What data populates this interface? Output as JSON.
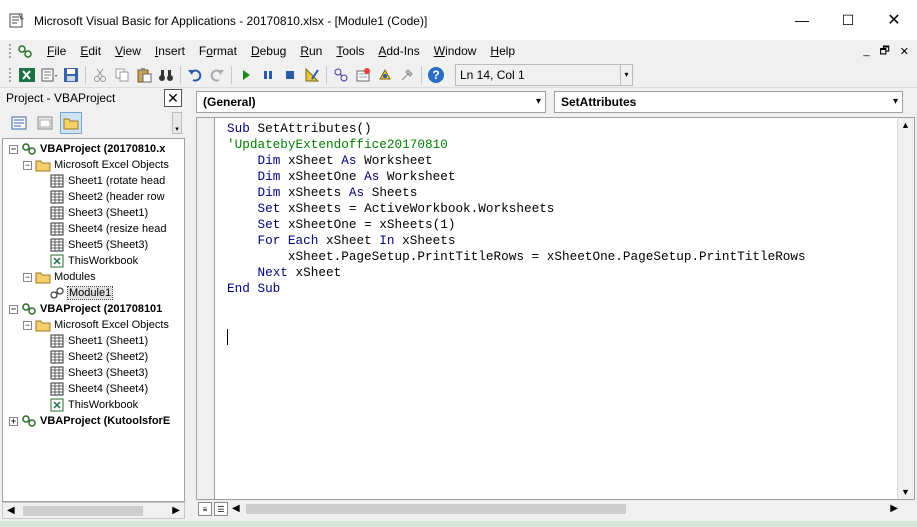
{
  "window": {
    "title": "Microsoft Visual Basic for Applications - 20170810.xlsx - [Module1 (Code)]",
    "minimize": "—",
    "maximize": "☐",
    "close": "✕"
  },
  "menu": {
    "items": [
      {
        "label": "File",
        "accel": "F",
        "rest": "ile"
      },
      {
        "label": "Edit",
        "accel": "E",
        "rest": "dit"
      },
      {
        "label": "View",
        "accel": "V",
        "rest": "iew"
      },
      {
        "label": "Insert",
        "accel": "I",
        "rest": "nsert"
      },
      {
        "label": "Format",
        "accel": "o",
        "pre": "F",
        "rest": "rmat"
      },
      {
        "label": "Debug",
        "accel": "D",
        "rest": "ebug"
      },
      {
        "label": "Run",
        "accel": "R",
        "rest": "un"
      },
      {
        "label": "Tools",
        "accel": "T",
        "rest": "ools"
      },
      {
        "label": "Add-Ins",
        "accel": "A",
        "rest": "dd-Ins"
      },
      {
        "label": "Window",
        "accel": "W",
        "rest": "indow"
      },
      {
        "label": "Help",
        "accel": "H",
        "rest": "elp"
      }
    ],
    "mdi_min": "_",
    "mdi_restore": "🗗",
    "mdi_close": "✕"
  },
  "toolbar": {
    "position": "Ln 14, Col 1"
  },
  "project": {
    "header": "Project - VBAProject",
    "close": "✕",
    "tree": [
      {
        "label": "VBAProject (20170810.x",
        "level": 0,
        "expander": "−",
        "bold": true,
        "icon": "vbaproject-icon"
      },
      {
        "label": "Microsoft Excel Objects",
        "level": 1,
        "expander": "−",
        "icon": "folder-icon"
      },
      {
        "label": "Sheet1 (rotate head",
        "level": 2,
        "icon": "sheet-icon"
      },
      {
        "label": "Sheet2 (header row",
        "level": 2,
        "icon": "sheet-icon"
      },
      {
        "label": "Sheet3 (Sheet1)",
        "level": 2,
        "icon": "sheet-icon"
      },
      {
        "label": "Sheet4 (resize head",
        "level": 2,
        "icon": "sheet-icon"
      },
      {
        "label": "Sheet5 (Sheet3)",
        "level": 2,
        "icon": "sheet-icon"
      },
      {
        "label": "ThisWorkbook",
        "level": 2,
        "icon": "workbook-icon"
      },
      {
        "label": "Modules",
        "level": 1,
        "expander": "−",
        "icon": "folder-icon"
      },
      {
        "label": "Module1",
        "level": 2,
        "icon": "module-icon",
        "selected": true
      },
      {
        "label": "VBAProject (201708101",
        "level": 0,
        "expander": "−",
        "bold": true,
        "icon": "vbaproject-icon"
      },
      {
        "label": "Microsoft Excel Objects",
        "level": 1,
        "expander": "−",
        "icon": "folder-icon"
      },
      {
        "label": "Sheet1 (Sheet1)",
        "level": 2,
        "icon": "sheet-icon"
      },
      {
        "label": "Sheet2 (Sheet2)",
        "level": 2,
        "icon": "sheet-icon"
      },
      {
        "label": "Sheet3 (Sheet3)",
        "level": 2,
        "icon": "sheet-icon"
      },
      {
        "label": "Sheet4 (Sheet4)",
        "level": 2,
        "icon": "sheet-icon"
      },
      {
        "label": "ThisWorkbook",
        "level": 2,
        "icon": "workbook-icon"
      },
      {
        "label": "VBAProject (KutoolsforE",
        "level": 0,
        "expander": "+",
        "bold": true,
        "icon": "vbaproject-icon"
      }
    ]
  },
  "code": {
    "object_combo": "(General)",
    "procedure_combo": "SetAttributes",
    "lines": [
      [
        {
          "t": "Sub ",
          "k": "kw"
        },
        {
          "t": "SetAttributes()"
        }
      ],
      [
        {
          "t": "'UpdatebyExtendoffice20170810",
          "k": "cm"
        }
      ],
      [
        {
          "t": "    "
        },
        {
          "t": "Dim ",
          "k": "kw"
        },
        {
          "t": "xSheet "
        },
        {
          "t": "As ",
          "k": "kw"
        },
        {
          "t": "Worksheet"
        }
      ],
      [
        {
          "t": "    "
        },
        {
          "t": "Dim ",
          "k": "kw"
        },
        {
          "t": "xSheetOne "
        },
        {
          "t": "As ",
          "k": "kw"
        },
        {
          "t": "Worksheet"
        }
      ],
      [
        {
          "t": "    "
        },
        {
          "t": "Dim ",
          "k": "kw"
        },
        {
          "t": "xSheets "
        },
        {
          "t": "As ",
          "k": "kw"
        },
        {
          "t": "Sheets"
        }
      ],
      [
        {
          "t": "    "
        },
        {
          "t": "Set ",
          "k": "kw"
        },
        {
          "t": "xSheets = ActiveWorkbook.Worksheets"
        }
      ],
      [
        {
          "t": "    "
        },
        {
          "t": "Set ",
          "k": "kw"
        },
        {
          "t": "xSheetOne = xSheets(1)"
        }
      ],
      [
        {
          "t": "    "
        },
        {
          "t": "For Each ",
          "k": "kw"
        },
        {
          "t": "xSheet "
        },
        {
          "t": "In ",
          "k": "kw"
        },
        {
          "t": "xSheets"
        }
      ],
      [
        {
          "t": "        xSheet.PageSetup.PrintTitleRows = xSheetOne.PageSetup.PrintTitleRows"
        }
      ],
      [
        {
          "t": "    "
        },
        {
          "t": "Next ",
          "k": "kw"
        },
        {
          "t": "xSheet"
        }
      ],
      [
        {
          "t": "End Sub",
          "k": "kw"
        }
      ]
    ]
  },
  "colors": {
    "keyword": "#00007f",
    "comment": "#007f00",
    "titlebar": "#ffffff",
    "chrome": "#f0f0f0"
  }
}
